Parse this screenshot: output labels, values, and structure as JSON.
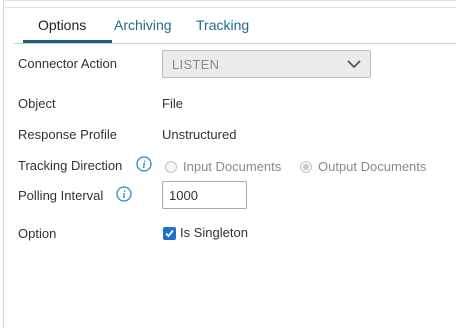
{
  "tabs": [
    {
      "label": "Options"
    },
    {
      "label": "Archiving"
    },
    {
      "label": "Tracking"
    }
  ],
  "fields": {
    "connector_action": {
      "label": "Connector Action",
      "value": "LISTEN"
    },
    "object": {
      "label": "Object",
      "value": "File"
    },
    "response_profile": {
      "label": "Response Profile",
      "value": "Unstructured"
    },
    "tracking_direction": {
      "label": "Tracking Direction",
      "options": [
        "Input Documents",
        "Output Documents"
      ],
      "selected": "Output Documents"
    },
    "polling_interval": {
      "label": "Polling Interval",
      "value": "1000"
    },
    "option": {
      "label": "Option",
      "checkbox_label": "Is Singleton",
      "checked": true
    }
  },
  "icons": {
    "info": "info-icon",
    "dropdown": "chevron-down-icon",
    "check": "checkmark-icon"
  },
  "colors": {
    "link_tab": "#1f6b8c",
    "active_underline": "#1f5f7a",
    "info_icon": "#2f8fbf",
    "checkbox": "#1a73c9"
  }
}
